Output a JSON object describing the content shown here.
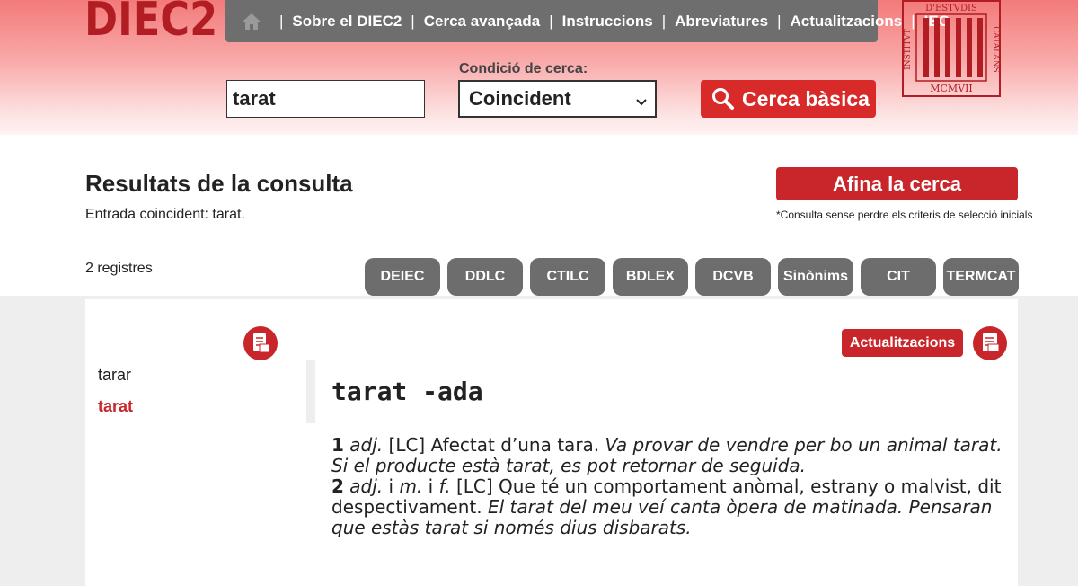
{
  "header": {
    "logo": "DIEC2",
    "nav": [
      "Sobre el DIEC2",
      "Cerca avançada",
      "Instruccions",
      "Abreviatures",
      "Actualitzacions",
      "IEC"
    ],
    "seal_text": "INSTITVT · D'ESTVDIS · CATALANS · MCMVII"
  },
  "search": {
    "query": "tarat",
    "condition_label": "Condició de cerca:",
    "condition_value": "Coincident",
    "button_label": "Cerca bàsica"
  },
  "results": {
    "title": "Resultats de la consulta",
    "subtitle": "Entrada coincident: tarat.",
    "refine_label": "Afina la cerca",
    "refine_note": "*Consulta sense perdre els criteris de selecció inicials",
    "count": "2 registres",
    "tabs": [
      "DEIEC",
      "DDLC",
      "CTILC",
      "BDLEX",
      "DCVB",
      "Sinònims",
      "CIT",
      "TERMCAT"
    ]
  },
  "list": [
    "tarar",
    "tarat"
  ],
  "entry": {
    "updates_label": "Actualitzacions",
    "headword": "tarat -ada",
    "sense1": {
      "num": "1",
      "gram": "adj.",
      "tag": "[LC]",
      "definition": "Afectat d’una tara.",
      "example": "Va provar de vendre per bo un animal tarat. Si el producte està tarat, es pot retornar de seguida."
    },
    "sense2": {
      "num": "2",
      "gram1": "adj.",
      "conj1": "i",
      "gram2": "m.",
      "conj2": "i",
      "gram3": "f.",
      "tag": "[LC]",
      "definition": "Que té un comportament anòmal, estrany o malvist, dit despectivament.",
      "example": "El tarat del meu veí canta òpera de matinada. Pensaran que estàs tarat si només dius disbarats."
    }
  },
  "colors": {
    "brand_red": "#c8262b",
    "nav_gray": "#6e6e6e",
    "tab_gray": "#6d6d6d"
  },
  "icons": [
    "home-icon",
    "search-icon",
    "chevron-down-icon",
    "pdf-icon",
    "print-icon"
  ]
}
